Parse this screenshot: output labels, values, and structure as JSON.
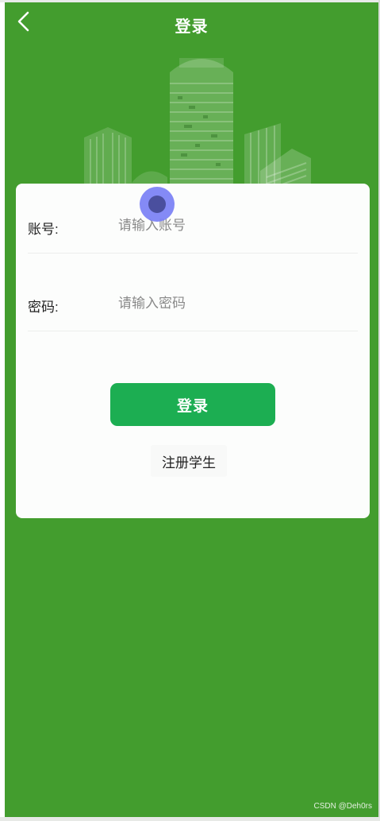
{
  "header": {
    "title": "登录",
    "back_icon": "chevron-left-icon"
  },
  "form": {
    "account": {
      "label": "账号:",
      "value": "",
      "placeholder": "请输入账号"
    },
    "password": {
      "label": "密码:",
      "value": "",
      "placeholder": "请输入密码"
    },
    "login_label": "登录",
    "register_label": "注册学生"
  },
  "watermark": "CSDN @Deh0rs",
  "colors": {
    "background": "#439d2e",
    "primary_button": "#1cae52",
    "card": "#fcfdfc"
  }
}
